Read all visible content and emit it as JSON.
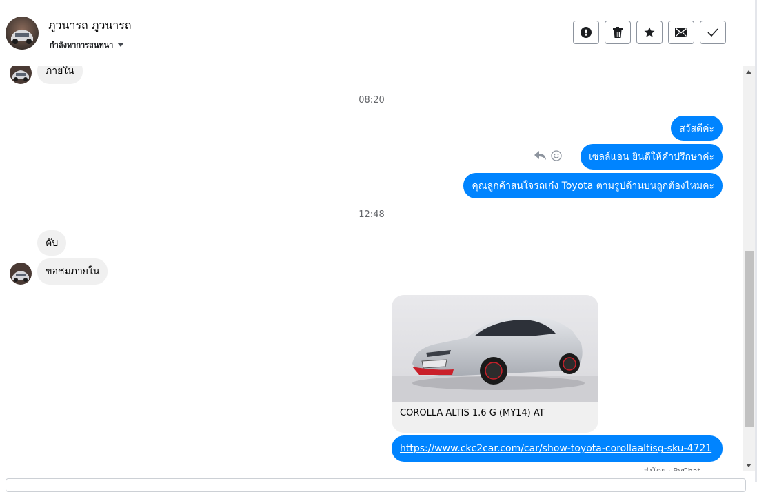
{
  "header": {
    "contact_name": "ภูวนารถ ภูวนารถ",
    "stage_label": "กำลังหาการสนทนา",
    "actions": [
      {
        "name": "spam-button",
        "icon": "exclamation-circle-icon"
      },
      {
        "name": "delete-button",
        "icon": "trash-icon"
      },
      {
        "name": "star-button",
        "icon": "star-icon"
      },
      {
        "name": "mark-unread-button",
        "icon": "envelope-icon"
      },
      {
        "name": "done-button",
        "icon": "checkmark-icon"
      }
    ]
  },
  "messages": {
    "m1": "ภายใน",
    "t1": "08:20",
    "m2": "สวัสดีค่ะ",
    "m3": "เซลล์แอน ยินดีให้คำปรึกษาค่ะ",
    "m4": "คุณลูกค้าสนใจรถเก๋ง Toyota ตามรูปด้านบนถูกต้องไหมคะ",
    "t2": "12:48",
    "m5": "คับ",
    "m6": "ขอชมภายใน",
    "card_title": "COROLLA ALTIS 1.6 G (MY14) AT",
    "link": "https://www.ckc2car.com/car/show-toyota-corollaaltisg-sku-4721",
    "seen": "ส่งโดย · ByChat"
  },
  "colors": {
    "outgoing_bubble": "#0084ff",
    "incoming_bubble": "#f0f0f0",
    "timestamp": "#65676b",
    "border": "#dddfe2"
  }
}
